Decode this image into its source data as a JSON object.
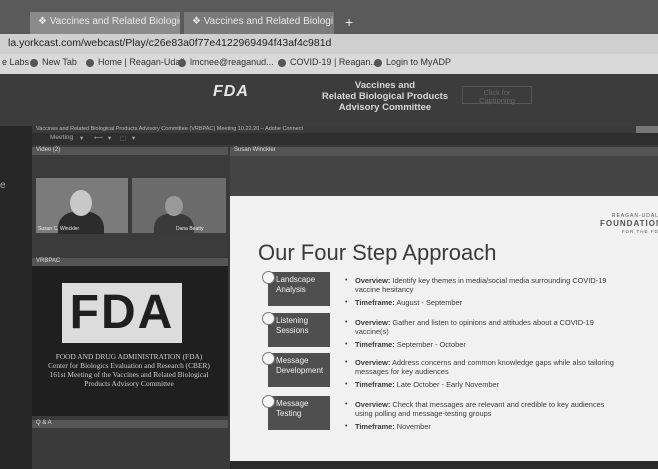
{
  "browser": {
    "tabs": [
      {
        "label": "Vaccines and Related Biological P",
        "close": "×"
      },
      {
        "label": "Vaccines and Related Biologi",
        "close": "×",
        "audio": "◀"
      }
    ],
    "new_tab": "+",
    "url": "la.yorkcast.com/webcast/Play/c26e83a0f77e4122969494f43af4c981d",
    "bookmarks": [
      "e Labs",
      "New Tab",
      "Home | Reagan-Udall",
      "lmcnee@reaganud...",
      "COVID-19 | Reagan...",
      "Login to MyADP"
    ]
  },
  "banner": {
    "logo": "FDA",
    "title_lines": [
      "Vaccines and",
      "Related Biological Products",
      "Advisory Committee"
    ],
    "caption_button": [
      "Click for",
      "Captioning"
    ]
  },
  "connect": {
    "window_title": "Vaccines and Related Biological Products Advisory Committee (VRBPAC) Meeting 10.22.20 – Adobe Connect",
    "menu": [
      "Meeting",
      "▾",
      "⟵",
      "▾",
      "⬚",
      "▾"
    ],
    "video_pod": {
      "label": "Video (2)",
      "cam1_name": "Susan C. Winckler",
      "cam2_name": "Dana Beatty"
    },
    "vrbpac_pod": {
      "label": "VRBPAC"
    },
    "fda_logo": "FDA",
    "fda_text": [
      "FOOD AND DRUG ADMINISTRATION (FDA)",
      "Center for Biologics Evaluation and Research (CBER)",
      "161st Meeting of the Vaccines and Related Biological",
      "Products Advisory Committee"
    ],
    "chat_pod": {
      "label": "Q & A"
    },
    "share_pod": {
      "label": "Susan Winckler"
    }
  },
  "slide": {
    "brand": [
      "REAGAN-UDALL",
      "FOUNDATION",
      "FOR THE FDA"
    ],
    "title": "Our Four Step Approach",
    "steps": [
      {
        "label_lines": [
          "Landscape",
          "Analysis"
        ],
        "bullets": [
          {
            "key": "Overview:",
            "text": " Identify key themes in media/social media surrounding COVID-19",
            "cont": "vaccine hesitancy"
          },
          {
            "key": "Timeframe:",
            "text": " August - September"
          }
        ]
      },
      {
        "label_lines": [
          "Listening",
          "Sessions"
        ],
        "bullets": [
          {
            "key": "Overview:",
            "text": " Gather and listen to opinions and attitudes about a COVID-19",
            "cont": "vaccine(s)"
          },
          {
            "key": "Timeframe:",
            "text": " September - October"
          }
        ]
      },
      {
        "label_lines": [
          "Message",
          "Development"
        ],
        "bullets": [
          {
            "key": "Overview:",
            "text": " Address concerns and common knowledge gaps while also tailoring",
            "cont": "messages for key audiences"
          },
          {
            "key": "Timeframe:",
            "text": " Late October - Early November"
          }
        ]
      },
      {
        "label_lines": [
          "Message",
          "Testing"
        ],
        "bullets": [
          {
            "key": "Overview:",
            "text": " Check that messages are relevant and credible to key audiences",
            "cont": "using polling and message-testing groups"
          },
          {
            "key": "Timeframe:",
            "text": " November"
          }
        ]
      }
    ]
  },
  "colors": {
    "slide_bg": "#f1f1f1",
    "step_box": "#4f4f4f",
    "dark_bg": "#2a2a2a"
  }
}
